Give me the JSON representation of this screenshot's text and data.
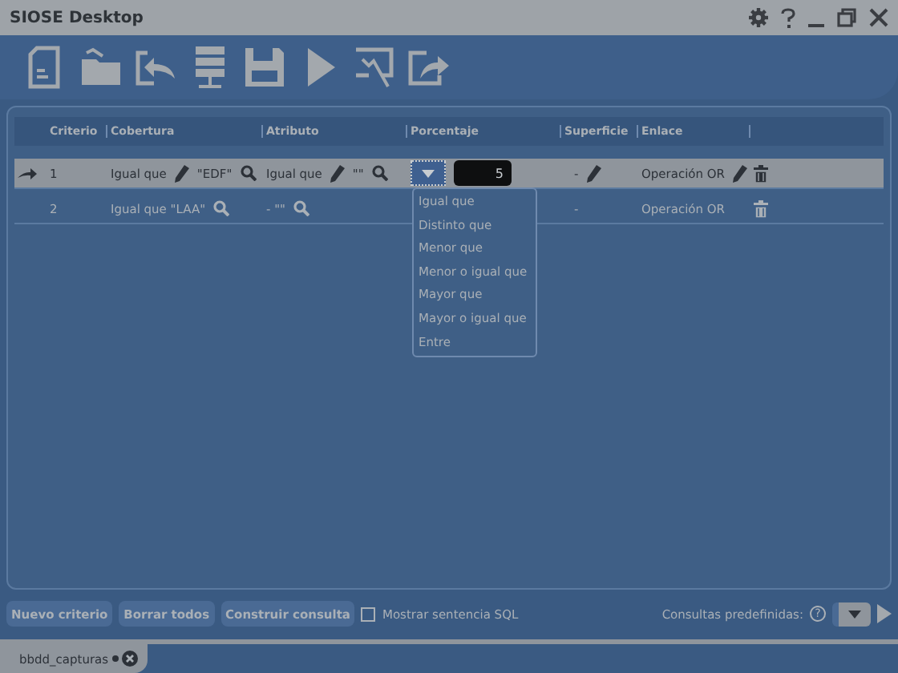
{
  "window": {
    "title": "SIOSE Desktop"
  },
  "table": {
    "columns": [
      "Criterio",
      "Cobertura",
      "Atributo",
      "Porcentaje",
      "Superficie",
      "Enlace"
    ],
    "rows": [
      {
        "selected": true,
        "editing": true,
        "criterio": "1",
        "cobertura": "Igual que",
        "cobertura_value": "\"EDF\"",
        "atributo": "Igual que",
        "atributo_value": "\"\"",
        "porcentaje": "5",
        "superficie": "-",
        "enlace": "Operación OR"
      },
      {
        "selected": false,
        "editing": false,
        "criterio": "2",
        "cobertura": "Igual que \"LAA\"",
        "atributo": "- \"\"",
        "superficie": "-",
        "enlace": "Operación OR"
      }
    ]
  },
  "operator_menu": {
    "options": [
      {
        "label": "Igual que",
        "selected": false
      },
      {
        "label": "Distinto que",
        "selected": false
      },
      {
        "label": "Menor que",
        "selected": false
      },
      {
        "label": "Menor o igual que",
        "selected": false
      },
      {
        "label": "Mayor que",
        "selected": false
      },
      {
        "label": "Mayor o igual que",
        "selected": false
      },
      {
        "label": "Entre",
        "selected": false
      }
    ]
  },
  "buttons": [
    "Nuevo criterio",
    "Borrar todos",
    "Construir consulta"
  ],
  "show_sql": {
    "label": "Mostrar sentencia SQL",
    "checked": false
  },
  "predefined": {
    "label": "Consultas predefinidas:",
    "help": "?"
  },
  "document_tab": {
    "label": "bbdd_capturas",
    "modified": true
  }
}
